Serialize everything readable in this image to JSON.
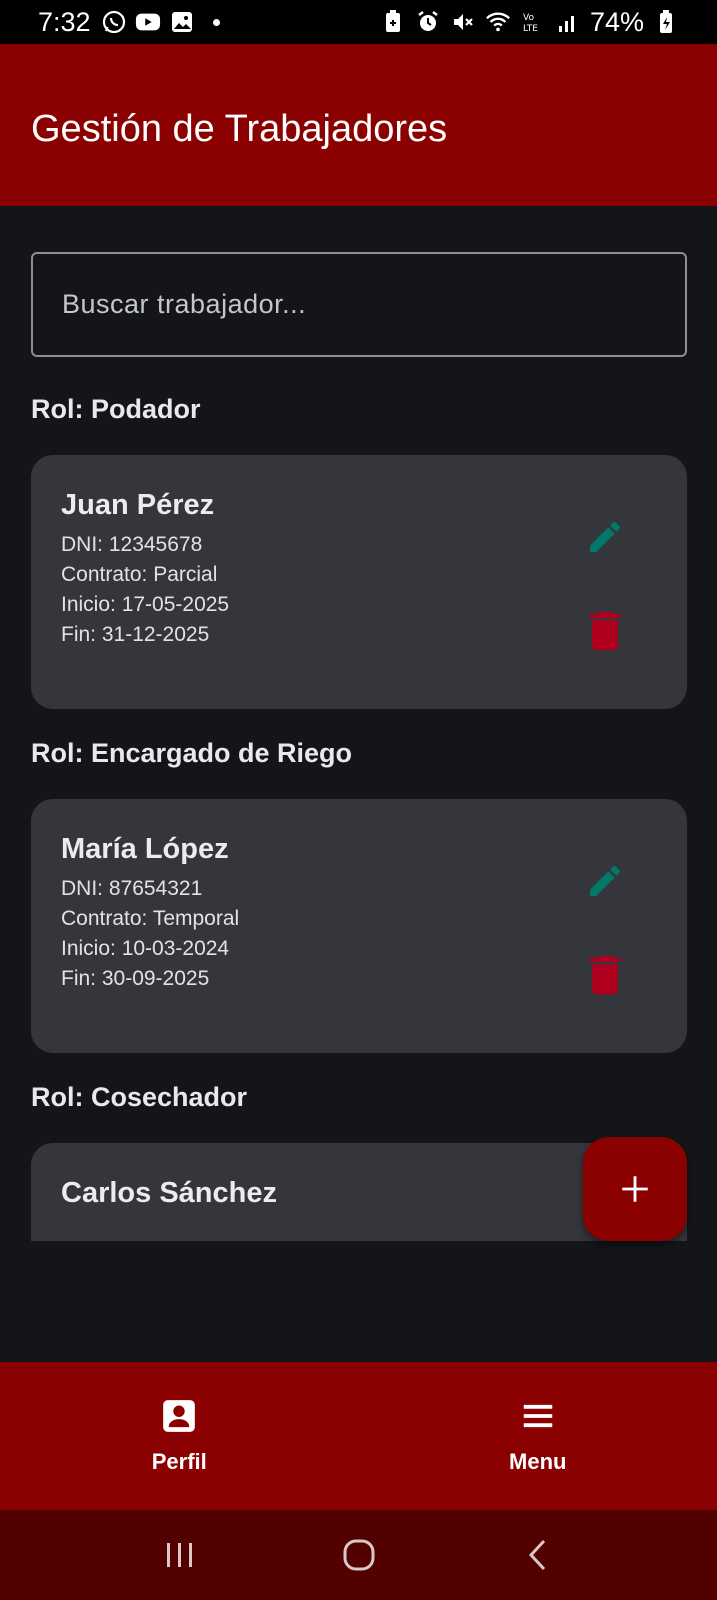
{
  "status_bar": {
    "time": "7:32",
    "battery_percent": "74%",
    "left_icons": [
      "whatsapp-icon",
      "youtube-icon",
      "gallery-icon"
    ],
    "right_icons": [
      "battery-saver-icon",
      "alarm-icon",
      "mute-icon",
      "wifi-icon",
      "volte-icon",
      "signal-icon",
      "battery-icon"
    ]
  },
  "appbar": {
    "title": "Gestión de Trabajadores",
    "color": "#8b0000"
  },
  "search": {
    "placeholder": "Buscar trabajador..."
  },
  "groups": [
    {
      "heading": "Rol: Podador",
      "worker": {
        "name": "Juan Pérez",
        "dni": "DNI: 12345678",
        "contract": "Contrato: Parcial",
        "start": "Inicio: 17-05-2025",
        "end": "Fin: 31-12-2025"
      }
    },
    {
      "heading": "Rol: Encargado de Riego",
      "worker": {
        "name": "María López",
        "dni": "DNI: 87654321",
        "contract": "Contrato: Temporal",
        "start": "Inicio: 10-03-2024",
        "end": "Fin: 30-09-2025"
      }
    },
    {
      "heading": "Rol: Cosechador",
      "worker": {
        "name": "Carlos Sánchez"
      }
    }
  ],
  "colors": {
    "edit_icon": "#00796b",
    "delete_icon": "#b00020",
    "card_bg": "#35363b",
    "page_bg": "#131519"
  },
  "fab": {
    "icon": "plus-icon"
  },
  "bottom_nav": {
    "items": [
      {
        "label": "Perfil",
        "icon": "profile-icon"
      },
      {
        "label": "Menu",
        "icon": "menu-icon"
      }
    ]
  },
  "system_nav": {
    "buttons": [
      "recents-icon",
      "home-icon",
      "back-icon"
    ]
  }
}
